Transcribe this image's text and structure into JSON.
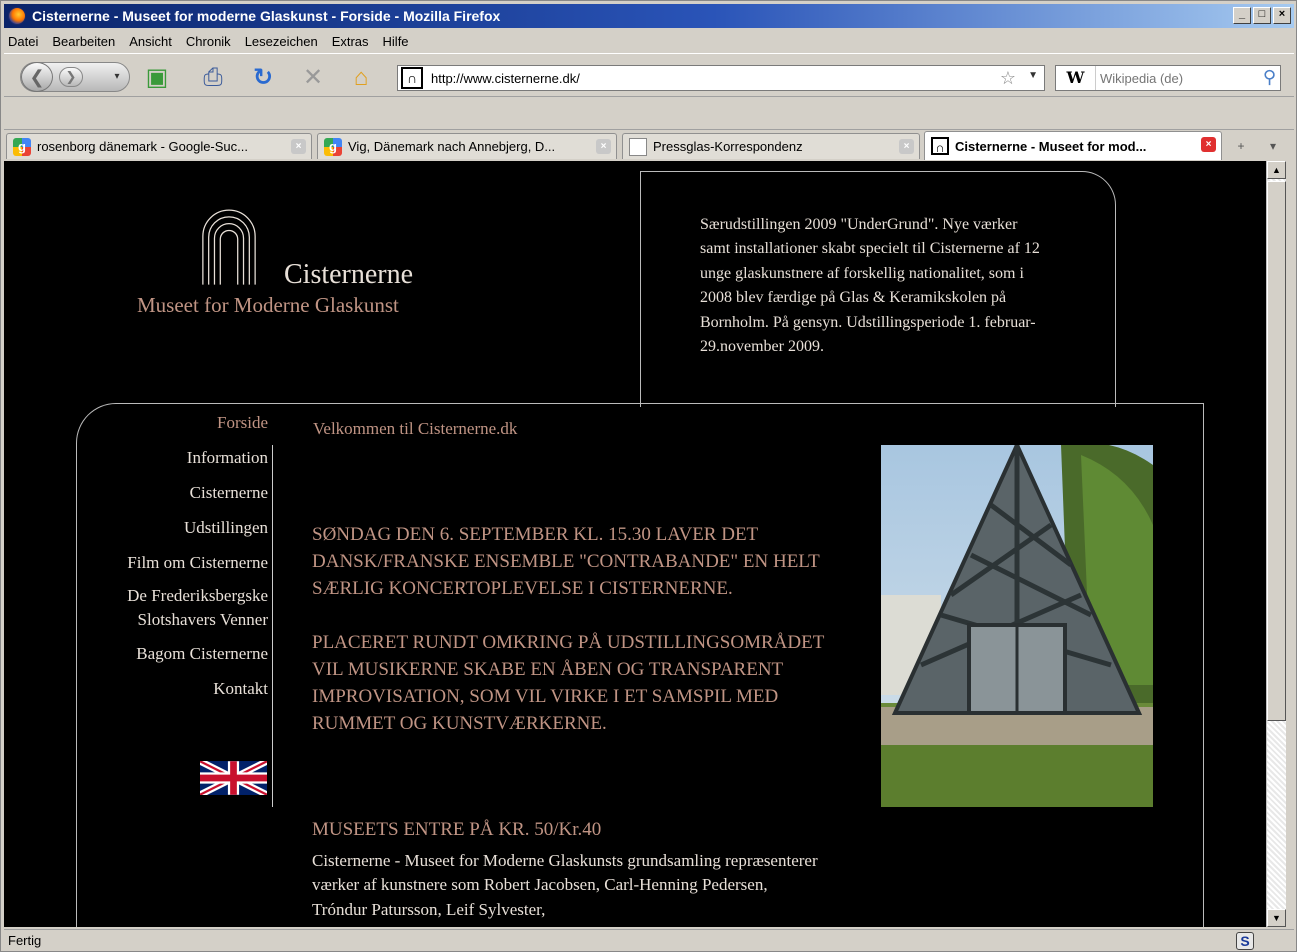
{
  "window": {
    "title": "Cisternerne - Museet for moderne Glaskunst - Forside - Mozilla Firefox",
    "minimize": "_",
    "maximize": "□",
    "close": "×"
  },
  "menu": [
    "Datei",
    "Bearbeiten",
    "Ansicht",
    "Chronik",
    "Lesezeichen",
    "Extras",
    "Hilfe"
  ],
  "navbar": {
    "url": "http://www.cisternerne.dk/",
    "search_engine": "W",
    "search_placeholder": "Wikipedia (de)"
  },
  "tabs": [
    {
      "label": "rosenborg dänemark - Google-Suc...",
      "icon": "google-icon",
      "active": false
    },
    {
      "label": "Vig, Dänemark nach Annebjerg, D...",
      "icon": "google-icon",
      "active": false
    },
    {
      "label": "Pressglas-Korrespondenz",
      "icon": "page-icon",
      "active": false
    },
    {
      "label": "Cisternerne - Museet for mod...",
      "icon": "site-icon",
      "active": true
    }
  ],
  "page": {
    "logo_name": "Cisternerne",
    "logo_subtitle": "Museet for Moderne Glaskunst",
    "info_text": "Særudstillingen 2009 \"UnderGrund\". Nye værker samt installationer skabt specielt til Cisternerne af 12 unge glaskunstnere af forskellig nationalitet, som i 2008 blev færdige på Glas & Keramikskolen på Bornholm. På gensyn. Udstillingsperiode 1. februar-29.november 2009.",
    "nav": [
      {
        "label": "Forside",
        "active": true
      },
      {
        "label": "Information",
        "active": false
      },
      {
        "label": "Cisternerne",
        "active": false
      },
      {
        "label": "Udstillingen",
        "active": false
      },
      {
        "label": "Film om Cisternerne",
        "active": false
      },
      {
        "label": "De Frederiksbergske Slotshavers Venner",
        "active": false
      },
      {
        "label": "Bagom Cisternerne",
        "active": false
      },
      {
        "label": "Kontakt",
        "active": false
      }
    ],
    "welcome": "Velkommen til Cisternerne.dk",
    "news_1": "SØNDAG DEN 6. SEPTEMBER KL. 15.30 LAVER DET DANSK/FRANSKE ENSEMBLE \"CONTRABANDE\" EN HELT SÆRLIG KONCERTOPLEVELSE I CISTERNERNE.",
    "news_2": "PLACERET RUNDT OMKRING PÅ UDSTILLINGSOMRÅDET VIL MUSIKERNE SKABE EN ÅBEN OG TRANSPARENT IMPROVISATION, SOM VIL VIRKE I ET SAMSPIL MED RUMMET OG KUNSTVÆRKERNE.",
    "price": "MUSEETS ENTRE PÅ  KR. 50/Kr.40",
    "collection": "Cisternerne - Museet for Moderne Glaskunsts grundsamling repræsenterer værker af kunstnere som Robert Jacobsen, Carl-Henning Pedersen, Tróndur Patursson, Leif Sylvester,"
  },
  "status": {
    "text": "Fertig",
    "addon_icon": "S"
  },
  "colors": {
    "page_bg": "#000000",
    "accent_text": "#c09484",
    "body_text": "#e8e0d8",
    "titlebar": "#0a246a"
  }
}
